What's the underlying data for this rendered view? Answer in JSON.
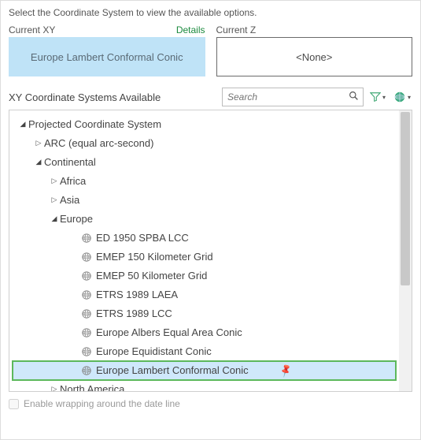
{
  "instruction": "Select the Coordinate System to view the available options.",
  "current": {
    "xy_label": "Current XY",
    "details_label": "Details",
    "xy_value": "Europe Lambert Conformal Conic",
    "z_label": "Current Z",
    "z_value": "<None>"
  },
  "available": {
    "label": "XY Coordinate Systems Available",
    "search_placeholder": "Search"
  },
  "tree": {
    "root": "Projected Coordinate System",
    "arc": "ARC (equal arc-second)",
    "continental": "Continental",
    "africa": "Africa",
    "asia": "Asia",
    "europe": "Europe",
    "north_america": "North America",
    "leaves": [
      "ED 1950 SPBA LCC",
      "EMEP 150 Kilometer Grid",
      "EMEP 50 Kilometer Grid",
      "ETRS 1989 LAEA",
      "ETRS 1989 LCC",
      "Europe Albers Equal Area Conic",
      "Europe Equidistant Conic",
      "Europe Lambert Conformal Conic"
    ]
  },
  "footer": {
    "wrap_label": "Enable wrapping around the date line"
  }
}
